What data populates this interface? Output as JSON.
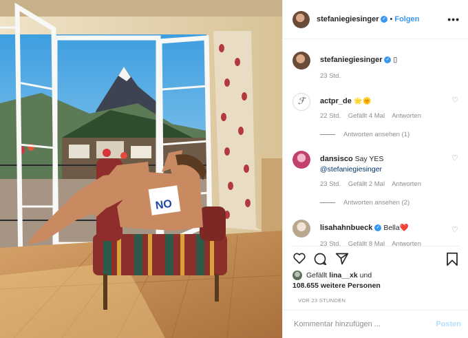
{
  "header": {
    "username": "stefaniegiesinger",
    "dot": "•",
    "follow_label": "Folgen",
    "more_icon": "more-horizontal-icon"
  },
  "caption": {
    "username": "stefaniegiesinger",
    "text": "▯",
    "time": "23 Std."
  },
  "comments": [
    {
      "username": "actpr_de",
      "text": "🌟🌞",
      "time": "22 Std.",
      "likes": "Gefällt 4 Mal",
      "reply": "Antworten",
      "view_replies": "Antworten ansehen (1)"
    },
    {
      "username": "dansisco",
      "text": "Say YES",
      "mention": "@stefaniegiesinger",
      "time": "23 Std.",
      "likes": "Gefällt 2 Mal",
      "reply": "Antworten",
      "view_replies": "Antworten ansehen (2)"
    },
    {
      "username": "lisahahnbueck",
      "text": "Bella❤️",
      "time": "23 Std.",
      "likes": "Gefällt 8 Mal",
      "reply": "Antworten"
    }
  ],
  "likes": {
    "prefix": "Gefällt",
    "user": "lina__xk",
    "middle": "und",
    "count": "108.655 weitere Personen"
  },
  "timestamp": "VOR 23 STUNDEN",
  "composer": {
    "placeholder": "Kommentar hinzufügen ...",
    "post_label": "Posten"
  },
  "photo": {
    "sign_text": "NO"
  },
  "colors": {
    "verified": "#3897f0",
    "link": "#3897f0",
    "muted": "#8e8e8e",
    "post_disabled": "#b2dffc"
  }
}
